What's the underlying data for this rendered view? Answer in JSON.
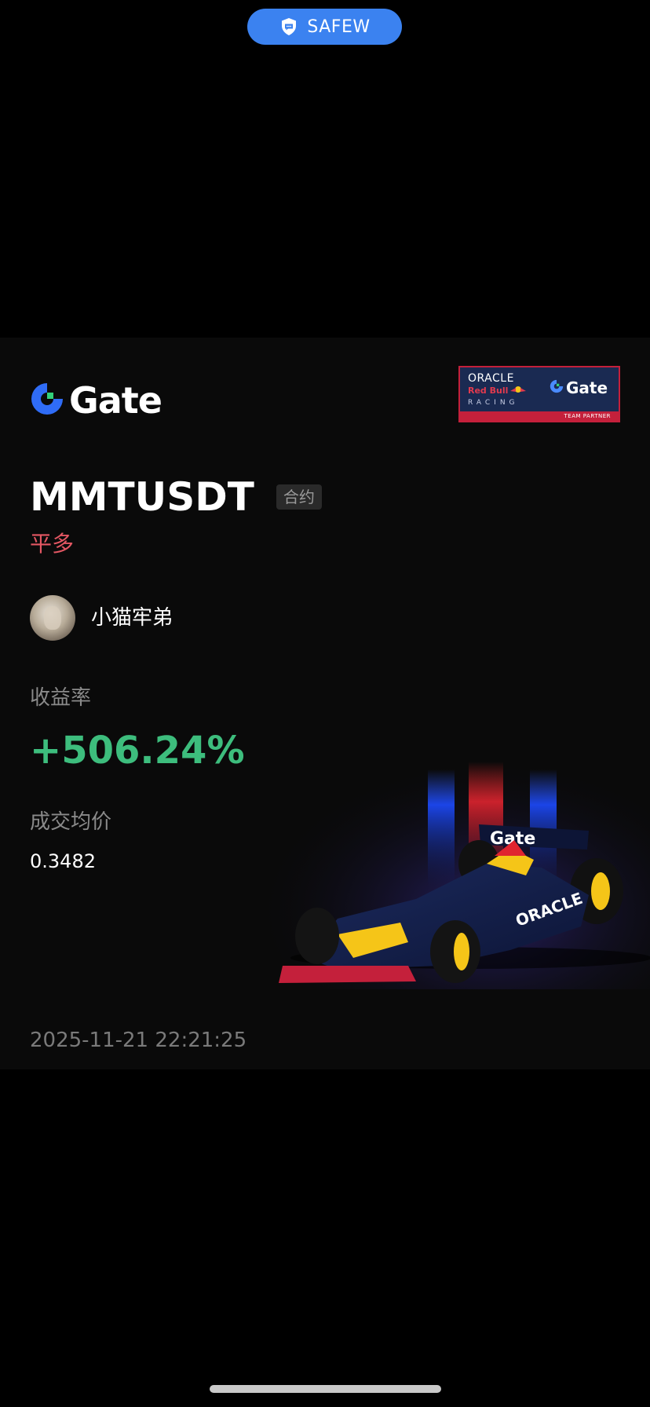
{
  "top_pill": {
    "label": "SAFEW",
    "icon": "chat-shield-icon",
    "color": "#3b82f0"
  },
  "card": {
    "brand": "Gate",
    "partner_badge": {
      "line1": "ORACLE",
      "line2": "Red Bull",
      "line3": "RACING",
      "brand": "Gate",
      "strip_text": "TEAM PARTNER"
    },
    "symbol": "MMTUSDT",
    "tag": "合约",
    "side": "平多",
    "user": {
      "name": "小猫牢弟"
    },
    "yield_label": "收益率",
    "yield_value": "+506.24%",
    "price_label": "成交均价",
    "price_value": "0.3482",
    "timestamp": "2025-11-21 22:21:25",
    "car_livery_text": "Gate",
    "car_sidepod_text": "ORACLE"
  },
  "colors": {
    "background": "#000000",
    "card_bg": "#0a0a0a",
    "positive": "#3dbd7d",
    "side_red": "#e45763",
    "accent_blue": "#3b82f0"
  }
}
